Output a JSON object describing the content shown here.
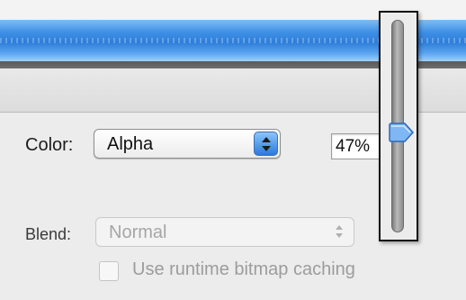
{
  "color_row": {
    "label": "Color:",
    "selected": "Alpha",
    "value": "47%"
  },
  "blend_row": {
    "label": "Blend:",
    "selected": "Normal",
    "enabled": false
  },
  "options": {
    "bitmap_caching_label": "Use runtime bitmap caching",
    "bitmap_caching_checked": false,
    "bitmap_caching_enabled": false
  },
  "alpha_slider": {
    "level_percent": 47
  },
  "colors": {
    "accent": "#3f8fe6",
    "stepper_blue": "#2a79df"
  },
  "icons": {
    "popup_stepper": "up-down-arrows-icon",
    "slider_thumb": "pointer-thumb-icon"
  }
}
